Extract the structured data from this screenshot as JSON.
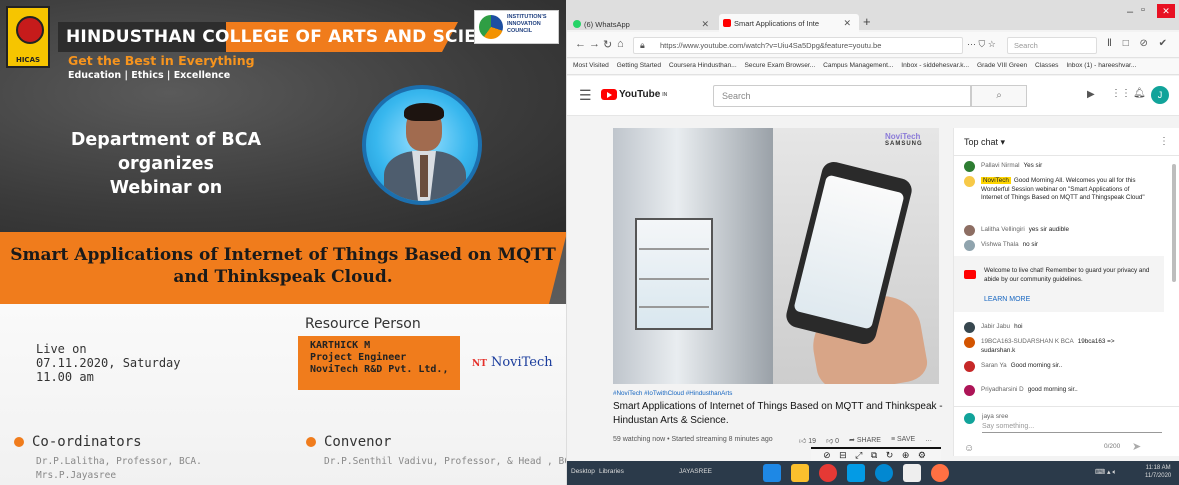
{
  "poster": {
    "logo_text": "HICAS",
    "college_name": "HINDUSTHAN COLLEGE OF ARTS AND SCIENCE",
    "tagline": "Get the Best in Everything",
    "values": "Education | Ethics | Excellence",
    "iic_text": "INSTITUTION'S INNOVATION COUNCIL",
    "dept_line1": "Department of BCA",
    "dept_line2": "organizes",
    "dept_line3": "Webinar on",
    "title_line1": "Smart Applications of Internet of Things Based on MQTT",
    "title_line2": "and Thinkspeak Cloud.",
    "resource_heading": "Resource Person",
    "resource_name": "KARTHICK M",
    "resource_role": "Project Engineer",
    "resource_org": "NoviTech R&D Pvt. Ltd.,",
    "novitech_logo_mark": "NT",
    "novitech_logo_text": "NoviTech",
    "live_on": "Live on",
    "date": "07.11.2020, Saturday",
    "time": "11.00 am",
    "coordinators_heading": "Co-ordinators",
    "coordinator_1": "Dr.P.Lalitha, Professor, BCA.",
    "coordinator_2": "Mrs.P.Jayasree",
    "convenor_heading": "Convenor",
    "convenor_1": "Dr.P.Senthil Vadivu, Professor, & Head , BCA."
  },
  "browser": {
    "tab1_title": "(6) WhatsApp",
    "tab2_title": "Smart Applications of Inte",
    "new_tab": "+",
    "url": "https://www.youtube.com/watch?v=Uiu4Sa5Dpg&feature=youtu.be",
    "url_actions": "⋯ ⛉ ☆",
    "search_placeholder": "Search",
    "nav_icons": "Ⅱ □ ⊘ ✔",
    "bookmarks": [
      "Most Visited",
      "Getting Started",
      "Coursera Hindusthan...",
      "Secure Exam Browser...",
      "Campus Management...",
      "Inbox - siddehesvar.k...",
      "Grade VIII Green",
      "Classes",
      "Inbox (1) - hareeshvar..."
    ]
  },
  "youtube": {
    "logo_text": "YouTube",
    "logo_sup": "IN",
    "search_placeholder": "Search",
    "avatar_letter": "J",
    "badge_brand": "NoviTech",
    "badge_sub": "SAMSUNG",
    "hashtags": "#NoviTech #IoTwithCloud #HindusthanArts",
    "video_title": "Smart Applications of Internet of Things Based on MQTT and Thinkspeak - Hindustan Arts & Science.",
    "video_meta": "59 watching now • Started streaming 8 minutes ago",
    "likes": "19",
    "dislikes": "0",
    "share": "SHARE",
    "save": "SAVE",
    "more": "…"
  },
  "chat": {
    "header": "Top chat ▾",
    "messages": [
      {
        "author": "Pallavi Nirmal",
        "text": "Yes sir",
        "color": "#2e7d32"
      },
      {
        "author": "NoviTech",
        "text": "Good Morning All. Welcomes you all for this Wonderful Session webinar on \"Smart Applications of Internet of Things Based on MQTT and Thingspeak Cloud\"",
        "color": "#f7c948"
      },
      {
        "author": "Lalitha Vellingiri",
        "text": "yes sir audible",
        "color": "#8d6e63"
      },
      {
        "author": "Vishwa Thala",
        "text": "no sir",
        "color": "#90a4ae"
      },
      {
        "author": "Jabir Jabu",
        "text": "hoi",
        "color": "#37474f"
      },
      {
        "author": "19BCA163-SUDARSHAN K BCA",
        "text": "19bca163 => sudarshan.k",
        "color": "#d35400"
      },
      {
        "author": "Saran Ya",
        "text": "Good morning sir..",
        "color": "#c62828"
      },
      {
        "author": "Priyadharsini D",
        "text": "good morning sir..",
        "color": "#ad1457"
      }
    ],
    "welcome": "Welcome to live chat! Remember to guard your privacy and abide by our community guidelines.",
    "learn_more": "LEARN MORE",
    "current_user": "jaya sree",
    "input_placeholder": "Say something...",
    "char_count": "0/200"
  },
  "taskbar": {
    "desktop": "Desktop",
    "libraries": "Libraries",
    "jayasree": "JAYASREE",
    "time": "11:18 AM",
    "date": "11/7/2020"
  },
  "colors": {
    "accent_orange": "#f07c1c",
    "youtube_red": "#ff0000",
    "taskbar": "#2b3a4a"
  }
}
